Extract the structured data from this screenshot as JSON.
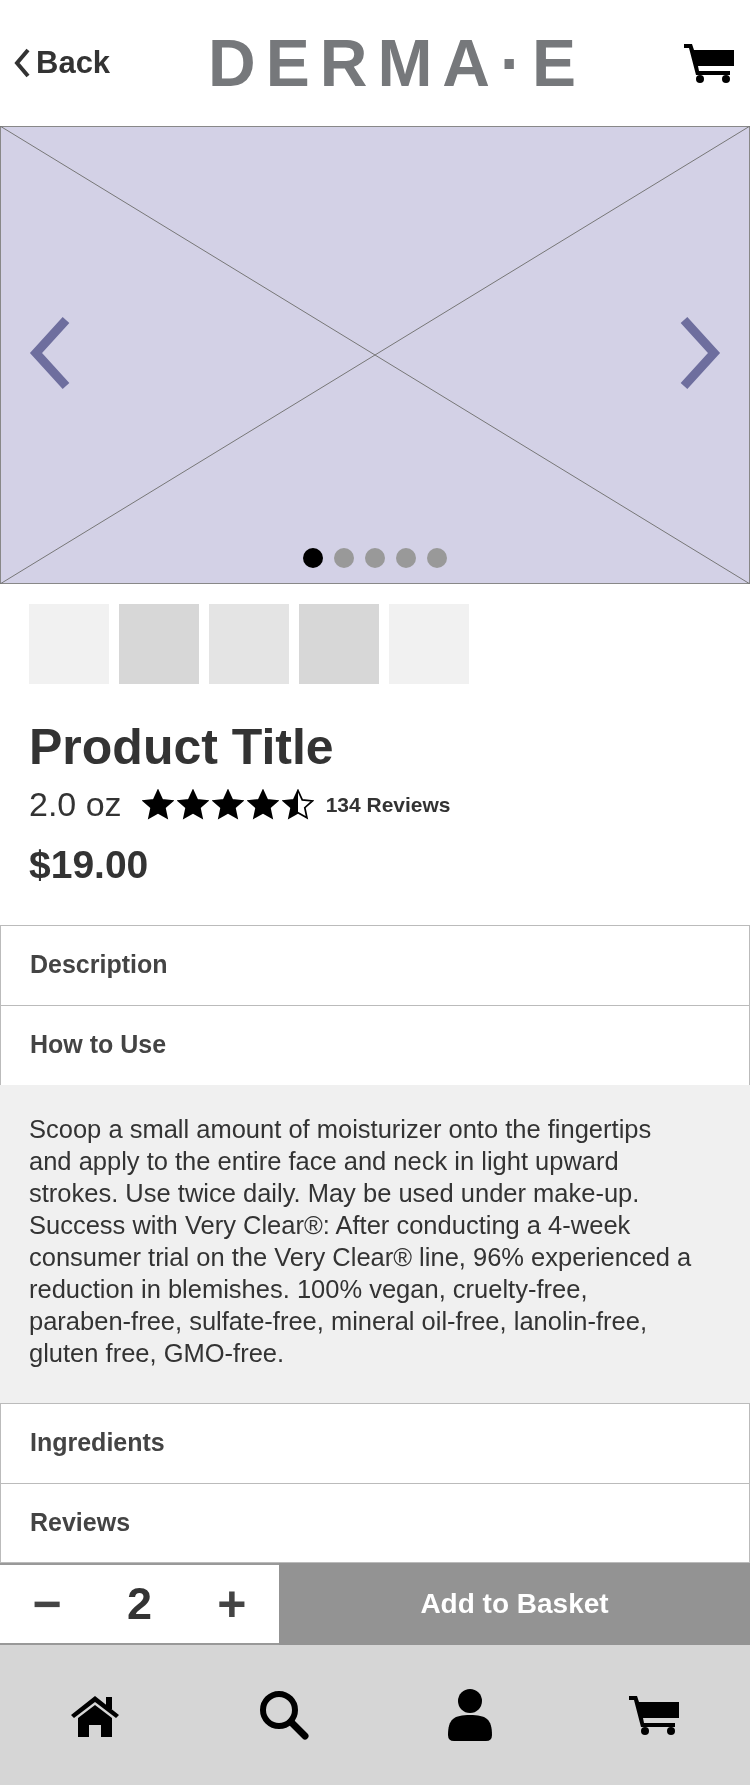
{
  "header": {
    "back": "Back",
    "logo": "DERMA·E"
  },
  "carousel": {
    "slides": [
      {
        "selected": true
      },
      {
        "selected": false
      },
      {
        "selected": false
      },
      {
        "selected": false
      },
      {
        "selected": false
      }
    ]
  },
  "thumbnails": [
    {
      "color": "#f1f1f1"
    },
    {
      "color": "#d7d7d7"
    },
    {
      "color": "#e4e4e4"
    },
    {
      "color": "#d7d7d7"
    },
    {
      "color": "#f1f1f1"
    }
  ],
  "product": {
    "title": "Product Title",
    "size": "2.0 oz",
    "stars": 4.5,
    "reviews": "134 Reviews",
    "price": "$19.00"
  },
  "sections": [
    {
      "title": "Description"
    },
    {
      "title": "How to Use",
      "body": [
        "Scoop a small amount of moisturizer onto the fingertips and apply to the entire face and neck in light upward strokes. Use twice daily. May be used under make-up.",
        "Success with Very Clear®: After conducting a 4-week consumer trial on the Very Clear® line, 96% experienced a reduction in blemishes. 100% vegan, cruelty-free, paraben-free, sulfate-free, mineral oil-free, lanolin-free, gluten free, GMO-free."
      ]
    },
    {
      "title": "Ingredients"
    },
    {
      "title": "Reviews"
    }
  ],
  "purchase": {
    "minus": "−",
    "quantity": "2",
    "plus": "+",
    "add_button": "Add to Basket"
  }
}
